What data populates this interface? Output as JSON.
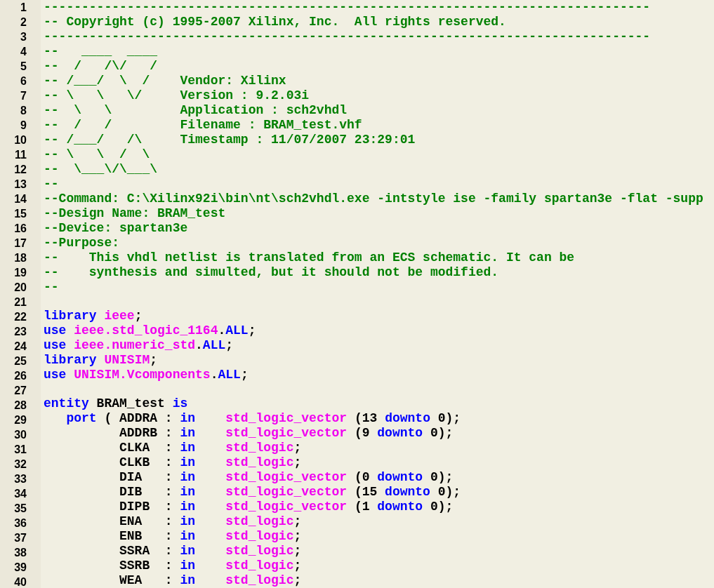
{
  "editor": {
    "lines": [
      {
        "number": "1",
        "tokens": [
          {
            "kind": "comment",
            "text": "--------------------------------------------------------------------------------"
          }
        ]
      },
      {
        "number": "2",
        "tokens": [
          {
            "kind": "comment",
            "text": "-- Copyright (c) 1995-2007 Xilinx, Inc.  All rights reserved."
          }
        ]
      },
      {
        "number": "3",
        "tokens": [
          {
            "kind": "comment",
            "text": "--------------------------------------------------------------------------------"
          }
        ]
      },
      {
        "number": "4",
        "tokens": [
          {
            "kind": "comment",
            "text": "--   ____  ____"
          }
        ]
      },
      {
        "number": "5",
        "tokens": [
          {
            "kind": "comment",
            "text": "--  /   /\\/   /"
          }
        ]
      },
      {
        "number": "6",
        "tokens": [
          {
            "kind": "comment",
            "text": "-- /___/  \\  /    Vendor: Xilinx"
          }
        ]
      },
      {
        "number": "7",
        "tokens": [
          {
            "kind": "comment",
            "text": "-- \\   \\   \\/     Version : 9.2.03i"
          }
        ]
      },
      {
        "number": "8",
        "tokens": [
          {
            "kind": "comment",
            "text": "--  \\   \\         Application : sch2vhdl"
          }
        ]
      },
      {
        "number": "9",
        "tokens": [
          {
            "kind": "comment",
            "text": "--  /   /         Filename : BRAM_test.vhf"
          }
        ]
      },
      {
        "number": "10",
        "tokens": [
          {
            "kind": "comment",
            "text": "-- /___/   /\\     Timestamp : 11/07/2007 23:29:01"
          }
        ]
      },
      {
        "number": "11",
        "tokens": [
          {
            "kind": "comment",
            "text": "-- \\   \\  /  \\"
          }
        ]
      },
      {
        "number": "12",
        "tokens": [
          {
            "kind": "comment",
            "text": "--  \\___\\/\\___\\"
          }
        ]
      },
      {
        "number": "13",
        "tokens": [
          {
            "kind": "comment",
            "text": "--"
          }
        ]
      },
      {
        "number": "14",
        "tokens": [
          {
            "kind": "comment",
            "text": "--Command: C:\\Xilinx92i\\bin\\nt\\sch2vhdl.exe -intstyle ise -family spartan3e -flat -supp"
          }
        ]
      },
      {
        "number": "15",
        "tokens": [
          {
            "kind": "comment",
            "text": "--Design Name: BRAM_test"
          }
        ]
      },
      {
        "number": "16",
        "tokens": [
          {
            "kind": "comment",
            "text": "--Device: spartan3e"
          }
        ]
      },
      {
        "number": "17",
        "tokens": [
          {
            "kind": "comment",
            "text": "--Purpose:"
          }
        ]
      },
      {
        "number": "18",
        "tokens": [
          {
            "kind": "comment",
            "text": "--    This vhdl netlist is translated from an ECS schematic. It can be"
          }
        ]
      },
      {
        "number": "19",
        "tokens": [
          {
            "kind": "comment",
            "text": "--    synthesis and simulted, but it should not be modified."
          }
        ]
      },
      {
        "number": "20",
        "tokens": [
          {
            "kind": "comment",
            "text": "--"
          }
        ]
      },
      {
        "number": "21"
      },
      {
        "number": "22",
        "tokens": [
          {
            "kind": "keyword",
            "text": "library "
          },
          {
            "kind": "type",
            "text": "ieee"
          },
          {
            "kind": "plain",
            "text": ";"
          }
        ]
      },
      {
        "number": "23",
        "tokens": [
          {
            "kind": "keyword",
            "text": "use "
          },
          {
            "kind": "type",
            "text": "ieee.std_logic_1164"
          },
          {
            "kind": "plain",
            "text": "."
          },
          {
            "kind": "keyword",
            "text": "ALL"
          },
          {
            "kind": "plain",
            "text": ";"
          }
        ]
      },
      {
        "number": "24",
        "tokens": [
          {
            "kind": "keyword",
            "text": "use "
          },
          {
            "kind": "type",
            "text": "ieee.numeric_std"
          },
          {
            "kind": "plain",
            "text": "."
          },
          {
            "kind": "keyword",
            "text": "ALL"
          },
          {
            "kind": "plain",
            "text": ";"
          }
        ]
      },
      {
        "number": "25",
        "tokens": [
          {
            "kind": "keyword",
            "text": "library "
          },
          {
            "kind": "type",
            "text": "UNISIM"
          },
          {
            "kind": "plain",
            "text": ";"
          }
        ]
      },
      {
        "number": "26",
        "tokens": [
          {
            "kind": "keyword",
            "text": "use "
          },
          {
            "kind": "type",
            "text": "UNISIM.Vcomponents"
          },
          {
            "kind": "plain",
            "text": "."
          },
          {
            "kind": "keyword",
            "text": "ALL"
          },
          {
            "kind": "plain",
            "text": ";"
          }
        ]
      },
      {
        "number": "27"
      },
      {
        "number": "28",
        "tokens": [
          {
            "kind": "keyword",
            "text": "entity"
          },
          {
            "kind": "plain",
            "text": " BRAM_test "
          },
          {
            "kind": "keyword",
            "text": "is"
          }
        ]
      },
      {
        "number": "29",
        "tokens": [
          {
            "kind": "keyword",
            "text": "   port"
          },
          {
            "kind": "plain",
            "text": " ( ADDRA : "
          },
          {
            "kind": "keyword",
            "text": "in"
          },
          {
            "kind": "type",
            "text": "    std_logic_vector"
          },
          {
            "kind": "plain",
            "text": " (13 "
          },
          {
            "kind": "keyword",
            "text": "downto"
          },
          {
            "kind": "plain",
            "text": " 0);"
          }
        ]
      },
      {
        "number": "30",
        "tokens": [
          {
            "kind": "plain",
            "text": "          ADDRB : "
          },
          {
            "kind": "keyword",
            "text": "in"
          },
          {
            "kind": "type",
            "text": "    std_logic_vector"
          },
          {
            "kind": "plain",
            "text": " (9 "
          },
          {
            "kind": "keyword",
            "text": "downto"
          },
          {
            "kind": "plain",
            "text": " 0);"
          }
        ]
      },
      {
        "number": "31",
        "tokens": [
          {
            "kind": "plain",
            "text": "          CLKA  : "
          },
          {
            "kind": "keyword",
            "text": "in"
          },
          {
            "kind": "type",
            "text": "    std_logic"
          },
          {
            "kind": "plain",
            "text": ";"
          }
        ]
      },
      {
        "number": "32",
        "tokens": [
          {
            "kind": "plain",
            "text": "          CLKB  : "
          },
          {
            "kind": "keyword",
            "text": "in"
          },
          {
            "kind": "type",
            "text": "    std_logic"
          },
          {
            "kind": "plain",
            "text": ";"
          }
        ]
      },
      {
        "number": "33",
        "tokens": [
          {
            "kind": "plain",
            "text": "          DIA   : "
          },
          {
            "kind": "keyword",
            "text": "in"
          },
          {
            "kind": "type",
            "text": "    std_logic_vector"
          },
          {
            "kind": "plain",
            "text": " (0 "
          },
          {
            "kind": "keyword",
            "text": "downto"
          },
          {
            "kind": "plain",
            "text": " 0);"
          }
        ]
      },
      {
        "number": "34",
        "tokens": [
          {
            "kind": "plain",
            "text": "          DIB   : "
          },
          {
            "kind": "keyword",
            "text": "in"
          },
          {
            "kind": "type",
            "text": "    std_logic_vector"
          },
          {
            "kind": "plain",
            "text": " (15 "
          },
          {
            "kind": "keyword",
            "text": "downto"
          },
          {
            "kind": "plain",
            "text": " 0);"
          }
        ]
      },
      {
        "number": "35",
        "tokens": [
          {
            "kind": "plain",
            "text": "          DIPB  : "
          },
          {
            "kind": "keyword",
            "text": "in"
          },
          {
            "kind": "type",
            "text": "    std_logic_vector"
          },
          {
            "kind": "plain",
            "text": " (1 "
          },
          {
            "kind": "keyword",
            "text": "downto"
          },
          {
            "kind": "plain",
            "text": " 0);"
          }
        ]
      },
      {
        "number": "36",
        "tokens": [
          {
            "kind": "plain",
            "text": "          ENA   : "
          },
          {
            "kind": "keyword",
            "text": "in"
          },
          {
            "kind": "type",
            "text": "    std_logic"
          },
          {
            "kind": "plain",
            "text": ";"
          }
        ]
      },
      {
        "number": "37",
        "tokens": [
          {
            "kind": "plain",
            "text": "          ENB   : "
          },
          {
            "kind": "keyword",
            "text": "in"
          },
          {
            "kind": "type",
            "text": "    std_logic"
          },
          {
            "kind": "plain",
            "text": ";"
          }
        ]
      },
      {
        "number": "38",
        "tokens": [
          {
            "kind": "plain",
            "text": "          SSRA  : "
          },
          {
            "kind": "keyword",
            "text": "in"
          },
          {
            "kind": "type",
            "text": "    std_logic"
          },
          {
            "kind": "plain",
            "text": ";"
          }
        ]
      },
      {
        "number": "39",
        "tokens": [
          {
            "kind": "plain",
            "text": "          SSRB  : "
          },
          {
            "kind": "keyword",
            "text": "in"
          },
          {
            "kind": "type",
            "text": "    std_logic"
          },
          {
            "kind": "plain",
            "text": ";"
          }
        ]
      },
      {
        "number": "40",
        "tokens": [
          {
            "kind": "plain",
            "text": "          WEA   : "
          },
          {
            "kind": "keyword",
            "text": "in"
          },
          {
            "kind": "type",
            "text": "    std_logic"
          },
          {
            "kind": "plain",
            "text": ";"
          }
        ]
      }
    ]
  }
}
